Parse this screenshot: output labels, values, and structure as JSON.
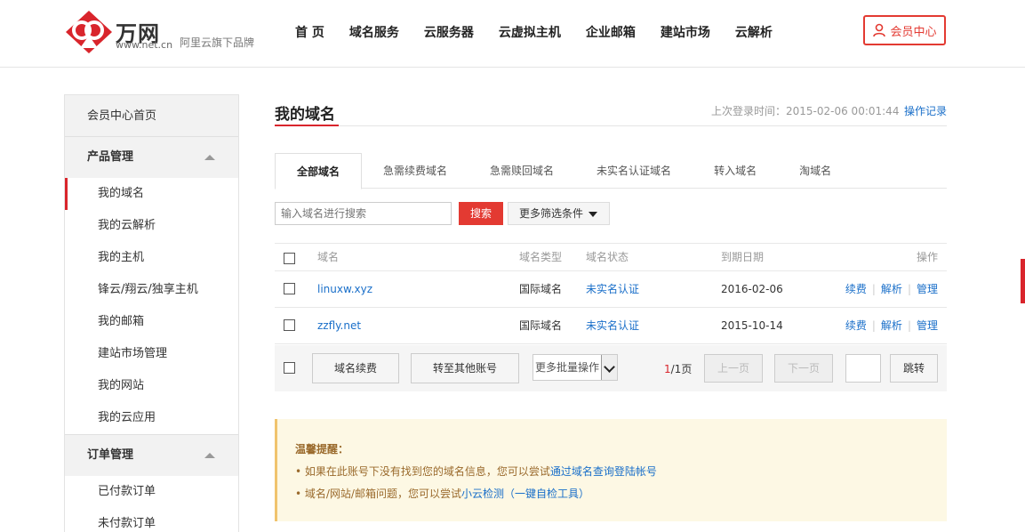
{
  "header": {
    "logo_name": "万网",
    "logo_url": "www.net.cn",
    "logo_slogan": "阿里云旗下品牌",
    "nav": [
      "首 页",
      "域名服务",
      "云服务器",
      "云虚拟主机",
      "企业邮箱",
      "建站市场",
      "云解析"
    ],
    "member_center": "会员中心",
    "brand_color": "#e33a32"
  },
  "sidebar": {
    "home": "会员中心首页",
    "groups": [
      {
        "title": "产品管理",
        "items": [
          "我的域名",
          "我的云解析",
          "我的主机",
          "锋云/翔云/独享主机",
          "我的邮箱",
          "建站市场管理",
          "我的网站",
          "我的云应用"
        ]
      },
      {
        "title": "订单管理",
        "items": [
          "已付款订单",
          "未付款订单"
        ]
      }
    ],
    "active_item": "我的域名"
  },
  "main": {
    "title": "我的域名",
    "last_login_label": "上次登录时间：2015-02-06 00:01:44",
    "op_log": "操作记录",
    "tabs": [
      "全部域名",
      "急需续费域名",
      "急需赎回域名",
      "未实名认证域名",
      "转入域名",
      "淘域名"
    ],
    "search": {
      "placeholder": "输入域名进行搜索",
      "button": "搜索",
      "filter": "更多筛选条件"
    },
    "table": {
      "headers": {
        "name": "域名",
        "type": "域名类型",
        "status": "域名状态",
        "date": "到期日期",
        "ops": "操作"
      },
      "rows": [
        {
          "name": "linuxw.xyz",
          "type": "国际域名",
          "status": "未实名认证",
          "date": "2016-02-06",
          "ops": [
            "续费",
            "解析",
            "管理"
          ]
        },
        {
          "name": "zzfly.net",
          "type": "国际域名",
          "status": "未实名认证",
          "date": "2015-10-14",
          "ops": [
            "续费",
            "解析",
            "管理"
          ]
        }
      ]
    },
    "batch": {
      "renew": "域名续费",
      "transfer": "转至其他账号",
      "more": "更多批量操作",
      "page_current": "1",
      "page_total": "/1页",
      "prev": "上一页",
      "next": "下一页",
      "jump": "跳转"
    },
    "notice": {
      "title": "温馨提醒：",
      "line1_text": "• 如果在此账号下没有找到您的域名信息，您可以尝试",
      "line1_link": "通过域名查询登陆帐号",
      "line2_text": "• 域名/网站/邮箱问题，您可以尝试",
      "line2_link": "小云检测（一键自检工具）"
    }
  }
}
